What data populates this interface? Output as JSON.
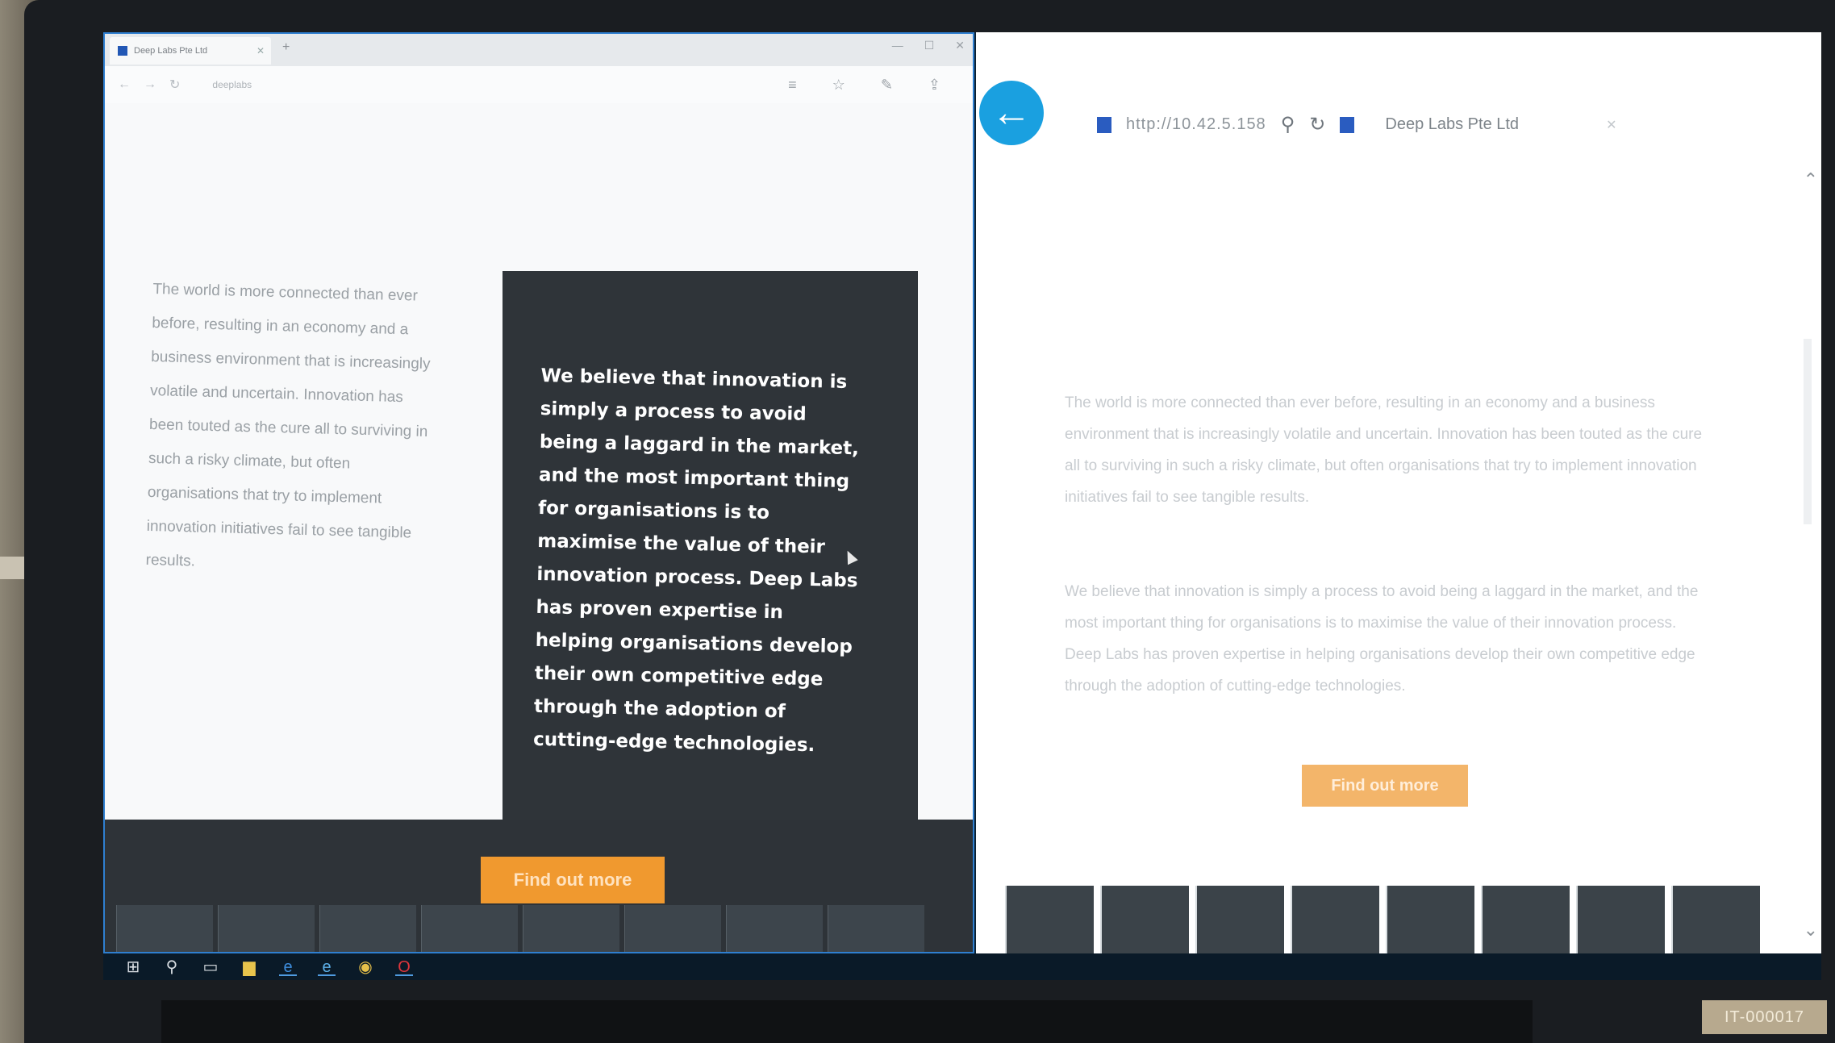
{
  "left_window": {
    "tab_title": "Deep Labs Pte Ltd",
    "url": "deeplabs",
    "left_paragraph": "The world is more connected than ever before, resulting in an economy and a business environment that is increasingly volatile and uncertain. Innovation has been touted as the cure all to surviving in such a risky climate, but often organisations that try to implement innovation initiatives fail to see tangible results.",
    "dark_paragraph": "We believe that innovation is simply a process to avoid being a laggard in the market, and the most important thing for organisations is to maximise the value of their innovation process. Deep Labs has proven expertise in helping organisations develop their own competitive edge through the adoption of cutting-edge technologies.",
    "cta_label": "Find out more"
  },
  "right_window": {
    "url": "http://10.42.5.158",
    "tab_title": "Deep Labs Pte Ltd",
    "paragraph_1": "The world is more connected than ever before, resulting in an economy and a business environment that is increasingly volatile and uncertain. Innovation has been touted as the cure all to surviving in such a risky climate, but often organisations that try to implement innovation initiatives fail to see tangible results.",
    "paragraph_2": "We believe that innovation is simply a process to avoid being a laggard in the market, and the most important thing for organisations is to maximise the value of their innovation process. Deep Labs has proven expertise in helping organisations develop their own competitive edge through the adoption of cutting-edge technologies.",
    "cta_label": "Find out more"
  },
  "asset_tag": "IT-000017",
  "icons": [
    "back-arrow-icon",
    "search-icon",
    "refresh-icon",
    "windows-start-icon",
    "search-taskbar-icon",
    "task-view-icon",
    "file-explorer-icon",
    "edge-icon",
    "ie-icon",
    "chrome-icon",
    "opera-icon"
  ],
  "colors": {
    "accent_orange": "#f0992f",
    "dark_panel": "#2f3439",
    "back_button": "#1aa0e0"
  }
}
